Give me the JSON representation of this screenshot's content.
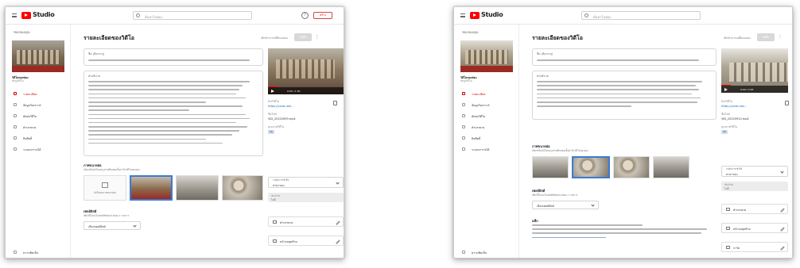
{
  "app": {
    "logo_text": "Studio",
    "search_placeholder": "ค้นหาในช่อง",
    "help_symbol": "?",
    "create_label": "สร้าง"
  },
  "screens": [
    {
      "nav": {
        "back_label": "ช่องของคุณ",
        "channel_title": "วิดีโอของช่อง",
        "channel_sub": "ข้อมูลวิดีโอ",
        "items": [
          "รายละเอียด",
          "ข้อมูลวิเคราะห์",
          "ตัดต่อวิดีโอ",
          "คำบรรยาย",
          "ลิขสิทธิ์",
          "ระบบหารายได้",
          "ความคิดเห็น"
        ],
        "active_index": 0
      },
      "main": {
        "title": "รายละเอียดของวิดีโอ",
        "undo_label": "เลิกทำการเปลี่ยนแปลง",
        "save_label": "บันทึก",
        "title_field_label": "ชื่อ (ต้องระบุ)",
        "desc_field_label": "คำอธิบาย",
        "thumbnail_title": "ภาพขนาดย่อ",
        "thumbnail_desc": "เลือกหรืออัปโหลดรูปภาพที่แสดงเนื้อหาในวิดีโอของคุณ",
        "upload_label": "อัปโหลดภาพขนาดย่อ",
        "playlist_title": "เพลย์ลิสต์",
        "playlist_desc": "เพิ่มวิดีโอลงในเพลย์ลิสต์อย่างน้อย 1 รายการ",
        "playlist_select": "เลือกเพลย์ลิสต์"
      },
      "side": {
        "time": "0:00 / 1:30",
        "link_label": "ลิงก์วิดีโอ",
        "link_value": "https://youtu.be/...",
        "file_label": "ชื่อไฟล์",
        "file_value": "VID_20220909.mp4",
        "quality_label": "คุณภาพวิดีโอ",
        "quality_badge": "HD",
        "visibility_label": "ระดับการเข้าถึง",
        "visibility_value": "สาธารณะ",
        "restrict_label": "ข้อจำกัด",
        "restrict_value": "ไม่มี",
        "rows": [
          "คำบรรยาย",
          "หน้าจอสุดท้าย"
        ]
      }
    },
    {
      "nav": {
        "back_label": "ช่องของคุณ",
        "channel_title": "วิดีโอของช่อง",
        "channel_sub": "ข้อมูลวิดีโอ",
        "items": [
          "รายละเอียด",
          "ข้อมูลวิเคราะห์",
          "ตัดต่อวิดีโอ",
          "คำบรรยาย",
          "ลิขสิทธิ์",
          "ระบบหารายได้",
          "ความคิดเห็น"
        ],
        "active_index": 0
      },
      "main": {
        "title": "รายละเอียดของวิดีโอ",
        "undo_label": "เลิกทำการเปลี่ยนแปลง",
        "save_label": "บันทึก",
        "title_field_label": "ชื่อ (ต้องระบุ)",
        "desc_field_label": "คำอธิบาย",
        "thumbnail_title": "ภาพขนาดย่อ",
        "thumbnail_desc": "เลือกหรืออัปโหลดรูปภาพที่แสดงเนื้อหาในวิดีโอของคุณ",
        "playlist_title": "เพลย์ลิสต์",
        "playlist_desc": "เพิ่มวิดีโอลงในเพลย์ลิสต์อย่างน้อย 1 รายการ",
        "playlist_select": "เลือกเพลย์ลิสต์",
        "tags_title": "แท็ก"
      },
      "side": {
        "time": "0:00 / 0:45",
        "link_label": "ลิงก์วิดีโอ",
        "link_value": "https://youtu.be/...",
        "file_label": "ชื่อไฟล์",
        "file_value": "VID_20220910.mp4",
        "quality_label": "คุณภาพวิดีโอ",
        "quality_badge": "HD",
        "visibility_label": "ระดับการเข้าถึง",
        "visibility_value": "สาธารณะ",
        "restrict_label": "ข้อจำกัด",
        "restrict_value": "ไม่มี",
        "rows": [
          "คำบรรยาย",
          "หน้าจอสุดท้าย",
          "การ์ด"
        ]
      }
    }
  ]
}
